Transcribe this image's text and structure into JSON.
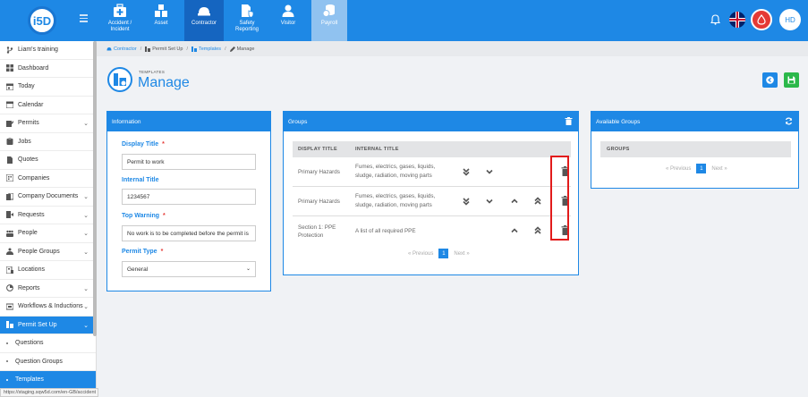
{
  "topbar": {
    "logo_text": "i5D",
    "modules": [
      {
        "label": "Accident / Incident",
        "icon": "first-aid-icon"
      },
      {
        "label": "Asset",
        "icon": "asset-icon"
      },
      {
        "label": "Contractor",
        "icon": "hard-hat-icon"
      },
      {
        "label": "Safety Reporting",
        "icon": "safety-report-icon"
      },
      {
        "label": "Visitor",
        "icon": "visitor-icon"
      },
      {
        "label": "Payroll",
        "icon": "payroll-icon"
      }
    ],
    "avatar": "HD"
  },
  "sidebar": {
    "items": [
      {
        "label": "Liam's training",
        "icon": "branch-icon"
      },
      {
        "label": "Dashboard",
        "icon": "dashboard-icon"
      },
      {
        "label": "Today",
        "icon": "calendar-day-icon"
      },
      {
        "label": "Calendar",
        "icon": "calendar-icon"
      },
      {
        "label": "Permits",
        "icon": "permits-icon"
      },
      {
        "label": "Jobs",
        "icon": "jobs-icon"
      },
      {
        "label": "Quotes",
        "icon": "quotes-icon"
      },
      {
        "label": "Companies",
        "icon": "companies-icon"
      },
      {
        "label": "Company Documents",
        "icon": "documents-icon"
      },
      {
        "label": "Requests",
        "icon": "requests-icon"
      },
      {
        "label": "People",
        "icon": "people-icon"
      },
      {
        "label": "People Groups",
        "icon": "people-groups-icon"
      },
      {
        "label": "Locations",
        "icon": "locations-icon"
      },
      {
        "label": "Reports",
        "icon": "reports-icon"
      },
      {
        "label": "Workflows & Inductions",
        "icon": "workflows-icon"
      },
      {
        "label": "Permit Set Up",
        "icon": "permit-setup-icon"
      },
      {
        "label": "Questions"
      },
      {
        "label": "Question Groups"
      },
      {
        "label": "Templates"
      }
    ],
    "status_url": "https://staging.sqw5d.com/en-GB/accident"
  },
  "breadcrumb": [
    "Contractor",
    "Permit Set Up",
    "Templates",
    "Manage"
  ],
  "page": {
    "overline": "TEMPLATES",
    "title": "Manage"
  },
  "info": {
    "heading": "Information",
    "display_title_label": "Display Title",
    "display_title_value": "Permit to work",
    "internal_title_label": "Internal Title",
    "internal_title_value": "1234567",
    "top_warning_label": "Top Warning",
    "top_warning_value": "No work is to be completed before the permit is",
    "permit_type_label": "Permit Type",
    "permit_type_value": "General",
    "required_mark": "*"
  },
  "groups": {
    "heading": "Groups",
    "columns": [
      "DISPLAY TITLE",
      "INTERNAL TITLE"
    ],
    "rows": [
      {
        "display": "Primary Hazards",
        "internal": "Fumes, electrics, gases, liquids, sludge, radiation, moving parts"
      },
      {
        "display": "Primary Hazards",
        "internal": "Fumes, electrics, gases, liquids, sludge, radiation, moving parts"
      },
      {
        "display": "Section 1: PPE Protection",
        "internal": "A list of all required PPE"
      }
    ],
    "pager": {
      "prev": "« Previous",
      "page": "1",
      "next": "Next »"
    }
  },
  "available": {
    "heading": "Available Groups",
    "column": "GROUPS",
    "pager": {
      "prev": "« Previous",
      "page": "1",
      "next": "Next »"
    }
  }
}
